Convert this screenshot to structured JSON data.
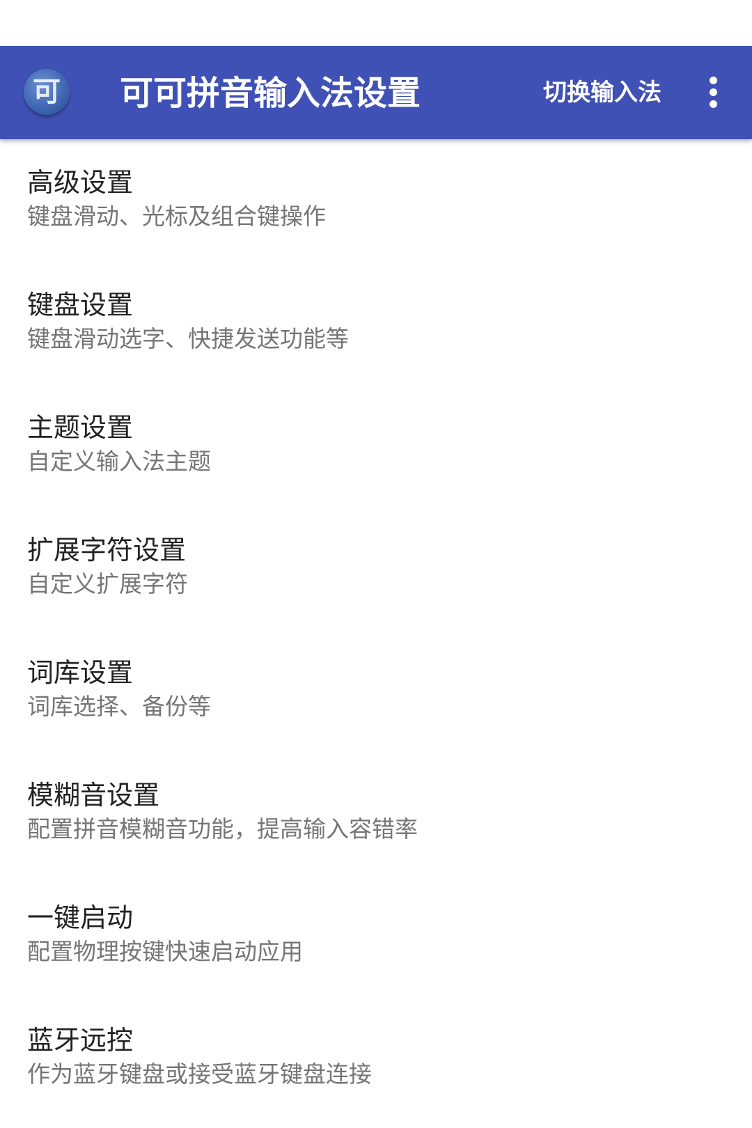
{
  "app_bar": {
    "icon_char": "可",
    "title": "可可拼音输入法设置",
    "action_label": "切换输入法",
    "menu_icon": "more-vert-icon",
    "background_color": "#3f51b5"
  },
  "settings": [
    {
      "title": "高级设置",
      "summary": "键盘滑动、光标及组合键操作"
    },
    {
      "title": "键盘设置",
      "summary": "键盘滑动选字、快捷发送功能等"
    },
    {
      "title": "主题设置",
      "summary": "自定义输入法主题"
    },
    {
      "title": "扩展字符设置",
      "summary": "自定义扩展字符"
    },
    {
      "title": "词库设置",
      "summary": "词库选择、备份等"
    },
    {
      "title": "模糊音设置",
      "summary": "配置拼音模糊音功能，提高输入容错率"
    },
    {
      "title": "一键启动",
      "summary": "配置物理按键快速启动应用"
    },
    {
      "title": "蓝牙远控",
      "summary": "作为蓝牙键盘或接受蓝牙键盘连接"
    }
  ]
}
